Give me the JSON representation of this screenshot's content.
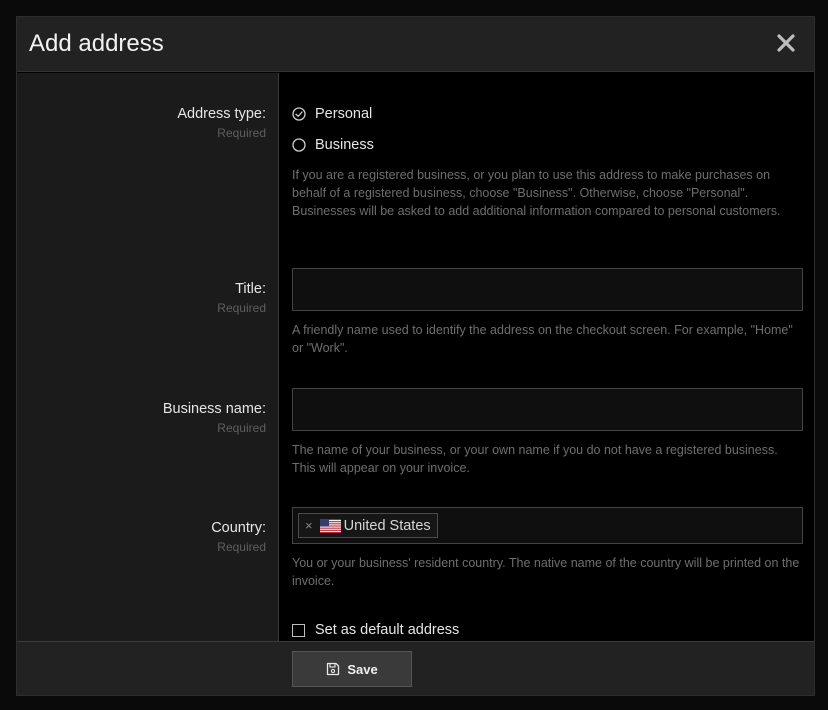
{
  "modal": {
    "title": "Add address",
    "close_icon": "close-icon"
  },
  "form": {
    "address_type": {
      "label": "Address type:",
      "required": "Required",
      "options": [
        {
          "label": "Personal",
          "selected": true
        },
        {
          "label": "Business",
          "selected": false
        }
      ],
      "help": "If you are a registered business, or you plan to use this address to make purchases on behalf of a registered business, choose \"Business\". Otherwise, choose \"Personal\". Businesses will be asked to add additional information compared to personal customers."
    },
    "title": {
      "label": "Title:",
      "required": "Required",
      "value": "",
      "help": "A friendly name used to identify the address on the checkout screen. For example, \"Home\" or \"Work\"."
    },
    "business_name": {
      "label": "Business name:",
      "required": "Required",
      "value": "",
      "help": "The name of your business, or your own name if you do not have a registered business. This will appear on your invoice."
    },
    "country": {
      "label": "Country:",
      "required": "Required",
      "selected": "United States",
      "remove_glyph": "×",
      "flag_icon": "us-flag-icon",
      "help": "You or your business' resident country. The native name of the country will be printed on the invoice."
    },
    "default_address": {
      "label": "Set as default address",
      "checked": false
    }
  },
  "footer": {
    "save_label": "Save",
    "save_icon": "floppy-disk-icon"
  },
  "colors": {
    "background": "#000000",
    "header": "#222222",
    "label_column": "#1b1b1b",
    "input_border": "#444444",
    "help_text": "#6e6e6e",
    "button": "#3a3a3a"
  }
}
